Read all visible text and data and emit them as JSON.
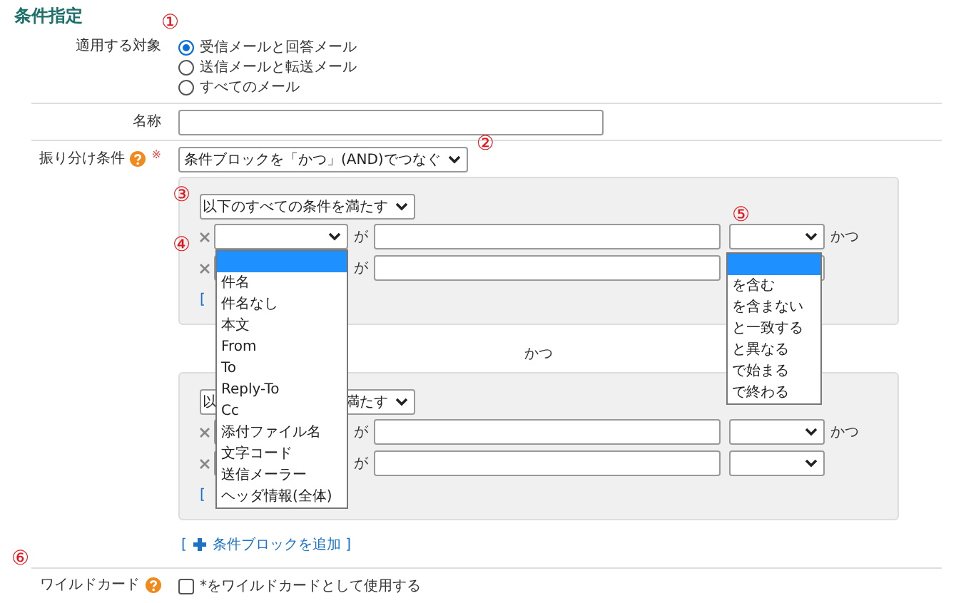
{
  "section_title": "条件指定",
  "fields": [
    {
      "kind": "radio",
      "label": "適用する対象",
      "options": [
        {
          "label": "受信メールと回答メール",
          "selected": true
        },
        {
          "label": "送信メールと転送メール",
          "selected": false
        },
        {
          "label": "すべてのメール",
          "selected": false
        }
      ]
    },
    {
      "kind": "text",
      "label": "名称"
    },
    {
      "kind": "conditions",
      "label": "振り分け条件",
      "help": true,
      "required_mark": "※",
      "mode_select": "条件ブロックを「かつ」(AND)でつなぐ",
      "blocks": [
        {
          "match_select": [
            "以下のすべての条件を満たす"
          ],
          "conditions": [
            {
              "particle": "が",
              "joiner": "かつ"
            },
            {
              "particle": "が"
            }
          ],
          "add_link": "["
        },
        {
          "match_select": [
            "以",
            "満たす"
          ],
          "conditions": [
            {
              "particle": "が",
              "joiner": "かつ"
            },
            {
              "particle": "が"
            }
          ],
          "add_link": "["
        }
      ],
      "block_joiner": "かつ",
      "add_block_link": {
        "open": "[",
        "label": "条件ブロックを追加",
        "close": "]"
      }
    },
    {
      "kind": "checkbox",
      "label": "ワイルドカード",
      "help": true,
      "option": {
        "label": "*をワイルドカードとして使用する",
        "checked": false
      }
    }
  ],
  "dropdowns": [
    {
      "items": [
        {
          "selected": true
        },
        {
          "label": "件名",
          "selected": false
        },
        {
          "label": "件名なし",
          "selected": false
        },
        {
          "label": "本文",
          "selected": false
        },
        {
          "label": "From",
          "selected": false
        },
        {
          "label": "To",
          "selected": false
        },
        {
          "label": "Reply-To",
          "selected": false
        },
        {
          "label": "Cc",
          "selected": false
        },
        {
          "label": "添付ファイル名",
          "selected": false
        },
        {
          "label": "文字コード",
          "selected": false
        },
        {
          "label": "送信メーラー",
          "selected": false
        },
        {
          "label": "ヘッダ情報(全体)",
          "selected": false
        }
      ]
    },
    {
      "items": [
        {
          "selected": true
        },
        {
          "label": "を含む",
          "selected": false
        },
        {
          "label": "を含まない",
          "selected": false
        },
        {
          "label": "と一致する",
          "selected": false
        },
        {
          "label": "と異なる",
          "selected": false
        },
        {
          "label": "で始まる",
          "selected": false
        },
        {
          "label": "で終わる",
          "selected": false
        }
      ]
    }
  ],
  "annotations": [
    "①",
    "②",
    "③",
    "④",
    "⑤",
    "⑥"
  ]
}
